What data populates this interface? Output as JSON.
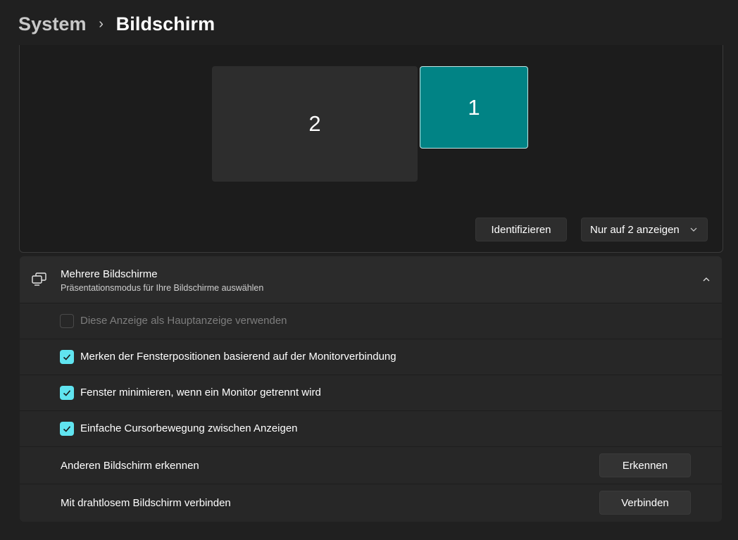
{
  "breadcrumb": {
    "parent": "System",
    "separator": "›",
    "current": "Bildschirm"
  },
  "arrangement": {
    "monitors": [
      {
        "label": "2",
        "selected": false,
        "color": "#2d2d2d"
      },
      {
        "label": "1",
        "selected": true,
        "color": "#018385"
      }
    ],
    "identify_label": "Identifizieren",
    "mode_dropdown": {
      "value": "Nur auf 2 anzeigen",
      "icon": "chevron-down-icon"
    }
  },
  "multiple_displays": {
    "icon": "multiple-displays-icon",
    "title": "Mehrere Bildschirme",
    "subtitle": "Präsentationsmodus für Ihre Bildschirme auswählen",
    "expanded": true,
    "options": [
      {
        "label": "Diese Anzeige als Hauptanzeige verwenden",
        "checked": false,
        "disabled": true
      },
      {
        "label": "Merken der Fensterpositionen basierend auf der Monitorverbindung",
        "checked": true,
        "disabled": false
      },
      {
        "label": "Fenster minimieren, wenn ein Monitor getrennt wird",
        "checked": true,
        "disabled": false
      },
      {
        "label": "Einfache Cursorbewegung zwischen Anzeigen",
        "checked": true,
        "disabled": false
      }
    ],
    "detect": {
      "label": "Anderen Bildschirm erkennen",
      "button": "Erkennen"
    },
    "wireless": {
      "label": "Mit drahtlosem Bildschirm verbinden",
      "button": "Verbinden"
    }
  },
  "colors": {
    "accent": "#60e4f0",
    "selected_monitor": "#018385",
    "background": "#202020"
  }
}
